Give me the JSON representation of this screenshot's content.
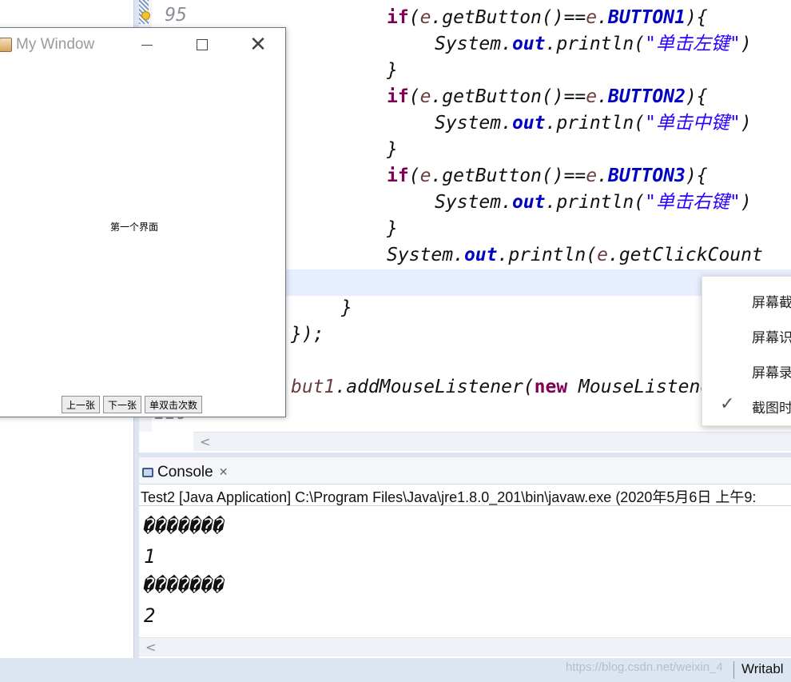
{
  "editor": {
    "line_numbers": [
      "95",
      "110"
    ],
    "code_lines": [
      [
        {
          "t": "if",
          "c": "kw"
        },
        {
          "t": "(",
          "c": ""
        },
        {
          "t": "e",
          "c": "var"
        },
        {
          "t": ".getButton()==",
          "c": ""
        },
        {
          "t": "e",
          "c": "var"
        },
        {
          "t": ".",
          "c": ""
        },
        {
          "t": "BUTTON1",
          "c": "fld"
        },
        {
          "t": "){",
          "c": ""
        }
      ],
      [
        {
          "t": "System.",
          "c": ""
        },
        {
          "t": "out",
          "c": "fld"
        },
        {
          "t": ".println(",
          "c": ""
        },
        {
          "t": "\"单击左键\"",
          "c": "str"
        },
        {
          "t": ")",
          "c": ""
        }
      ],
      [
        {
          "t": "}",
          "c": ""
        }
      ],
      [
        {
          "t": "if",
          "c": "kw"
        },
        {
          "t": "(",
          "c": ""
        },
        {
          "t": "e",
          "c": "var"
        },
        {
          "t": ".getButton()==",
          "c": ""
        },
        {
          "t": "e",
          "c": "var"
        },
        {
          "t": ".",
          "c": ""
        },
        {
          "t": "BUTTON2",
          "c": "fld"
        },
        {
          "t": "){",
          "c": ""
        }
      ],
      [
        {
          "t": "System.",
          "c": ""
        },
        {
          "t": "out",
          "c": "fld"
        },
        {
          "t": ".println(",
          "c": ""
        },
        {
          "t": "\"单击中键\"",
          "c": "str"
        },
        {
          "t": ")",
          "c": ""
        }
      ],
      [
        {
          "t": "}",
          "c": ""
        }
      ],
      [
        {
          "t": "if",
          "c": "kw"
        },
        {
          "t": "(",
          "c": ""
        },
        {
          "t": "e",
          "c": "var"
        },
        {
          "t": ".getButton()==",
          "c": ""
        },
        {
          "t": "e",
          "c": "var"
        },
        {
          "t": ".",
          "c": ""
        },
        {
          "t": "BUTTON3",
          "c": "fld"
        },
        {
          "t": "){",
          "c": ""
        }
      ],
      [
        {
          "t": "System.",
          "c": ""
        },
        {
          "t": "out",
          "c": "fld"
        },
        {
          "t": ".println(",
          "c": ""
        },
        {
          "t": "\"单击右键\"",
          "c": "str"
        },
        {
          "t": ")",
          "c": ""
        }
      ],
      [
        {
          "t": "}",
          "c": ""
        }
      ],
      [
        {
          "t": "System.",
          "c": ""
        },
        {
          "t": "out",
          "c": "fld"
        },
        {
          "t": ".println(",
          "c": ""
        },
        {
          "t": "e",
          "c": "var"
        },
        {
          "t": ".getClickCount",
          "c": ""
        }
      ],
      [],
      [
        {
          "t": "}",
          "c": ""
        }
      ],
      [
        {
          "t": "});",
          "c": ""
        }
      ],
      [],
      [
        {
          "t": "but1",
          "c": "var"
        },
        {
          "t": ".addMouseListener(",
          "c": ""
        },
        {
          "t": "new",
          "c": "kw"
        },
        {
          "t": " MouseListener()",
          "c": ""
        }
      ]
    ]
  },
  "context_menu": {
    "items": [
      "屏幕截",
      "屏幕识",
      "屏幕录",
      "截图时"
    ]
  },
  "console": {
    "tab_label": "Console",
    "description": "Test2 [Java Application] C:\\Program Files\\Java\\jre1.8.0_201\\bin\\javaw.exe (2020年5月6日 上午9:",
    "output_lines": [
      "�������",
      "1",
      "�������",
      "2"
    ]
  },
  "window": {
    "title": "My Window",
    "label": "第一个界面",
    "buttons": [
      "上一张",
      "下一张",
      "单双击次数"
    ]
  },
  "status": {
    "watermark": "https://blog.csdn.net/weixin_4",
    "writable": "Writabl"
  }
}
